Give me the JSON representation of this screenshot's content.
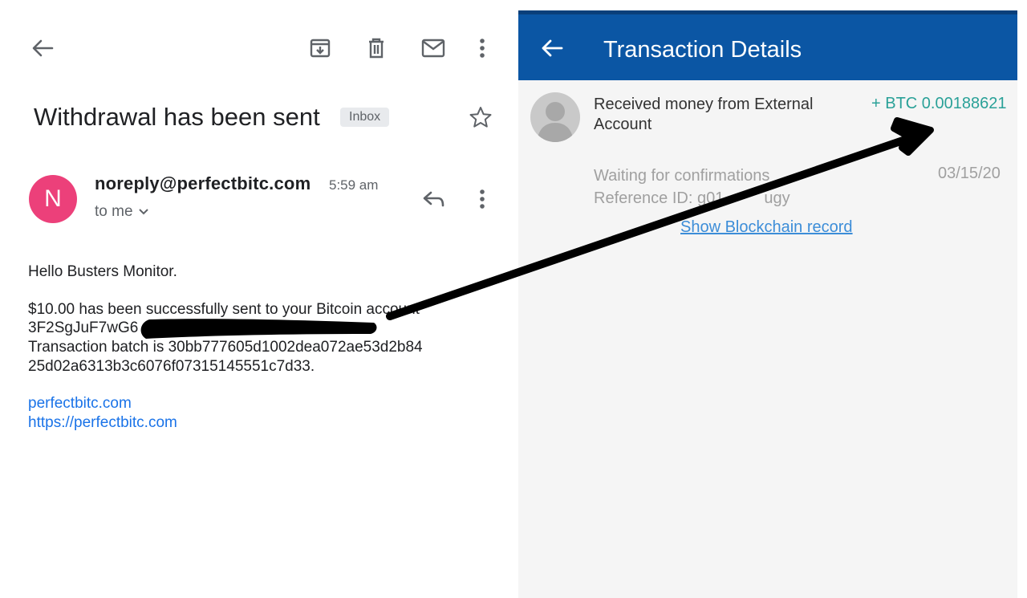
{
  "email": {
    "toolbar": {
      "back_icon": "arrow-left-icon",
      "archive_icon": "archive-icon",
      "delete_icon": "trash-icon",
      "mark_unread_icon": "mail-icon",
      "more_icon": "more-vertical-icon"
    },
    "subject": "Withdrawal has been sent",
    "label_badge": "Inbox",
    "star_icon": "star-outline-icon",
    "sender": {
      "avatar_letter": "N",
      "avatar_color": "#ec407a",
      "address": "noreply@perfectbitc.com",
      "time": "5:59 am",
      "recipient": "to me",
      "reply_icon": "reply-icon",
      "more_icon": "more-vertical-icon"
    },
    "body": {
      "greeting": "Hello Busters Monitor.",
      "line1": "$10.00 has been successfully sent to your Bitcoin account",
      "line2": "3F2SgJuF7wG6",
      "line3": "Transaction batch is 30bb777605d1002dea072ae53d2b84",
      "line4": "25d02a6313b3c6076f07315145551c7d33."
    },
    "links": [
      "perfectbitc.com",
      "https://perfectbitc.com"
    ]
  },
  "wallet": {
    "appbar": {
      "title": "Transaction Details",
      "back_icon": "arrow-left-icon",
      "color": "#0b56a4"
    },
    "transaction": {
      "description": "Received money from External Account",
      "amount": "+ BTC 0.00188621",
      "amount_color": "#2aa198",
      "status": "Waiting for confirmations",
      "reference": "Reference ID: g01",
      "reference_tail": "ugy",
      "date": "03/15/20",
      "link": "Show Blockchain record"
    }
  }
}
